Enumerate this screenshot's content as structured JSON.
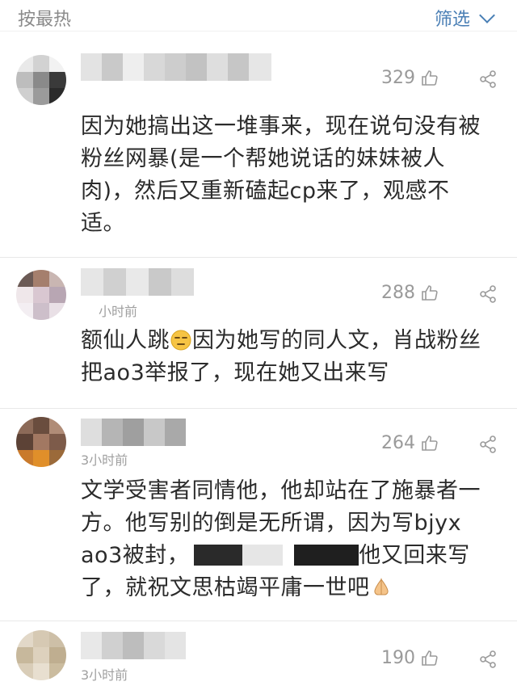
{
  "header": {
    "sort_label": "按最热",
    "filter_label": "筛选"
  },
  "icons": {
    "like": "thumbs-up-icon",
    "share": "share-icon",
    "filter_chevron": "chevron-down-icon"
  },
  "colors": {
    "accent": "#4a7fb5",
    "muted": "#9a9a9a",
    "text": "#2b2b2b"
  },
  "comments": [
    {
      "likes": "329",
      "time": "",
      "text_lines": [
        "因为她搞出这一堆事来，现在说句没有被",
        "粉丝网暴(是一个帮她说话的妹妹被人",
        "肉)，然后又重新磕起cp来了，观感不",
        "适。"
      ]
    },
    {
      "likes": "288",
      "time": "小时前",
      "text_part1": "额仙人跳",
      "text_part2": "因为她写的同人文，肖战粉丝",
      "text_line2": "把ao3举报了，现在她又出来写"
    },
    {
      "likes": "264",
      "time": "3小时前",
      "text_line1": "文学受害者同情他，他却站在了施暴者一",
      "text_line2": "方。他写别的倒是无所谓，因为写bjyx",
      "text_line3a": "ao3被封，",
      "text_line3b": "他又回来写",
      "text_line4": "了，就祝文思枯竭平庸一世吧"
    },
    {
      "likes": "190",
      "time": "3小时前"
    }
  ]
}
